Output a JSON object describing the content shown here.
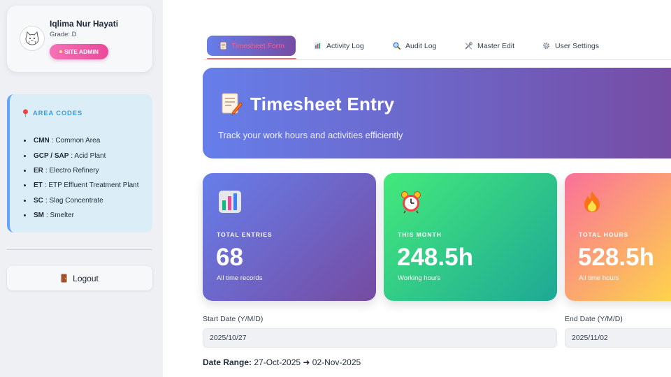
{
  "profile": {
    "name": "Iqlima Nur Hayati",
    "grade": "Grade: D",
    "badge": "SITE ADMIN"
  },
  "area_codes": {
    "title": "AREA CODES",
    "items": [
      {
        "code": "CMN",
        "name": ": Common Area"
      },
      {
        "code": "GCP / SAP",
        "name": ": Acid Plant"
      },
      {
        "code": "ER",
        "name": ": Electro Refinery"
      },
      {
        "code": "ET",
        "name": ": ETP Effluent Treatment Plant"
      },
      {
        "code": "SC",
        "name": ": Slag Concentrate"
      },
      {
        "code": "SM",
        "name": ": Smelter"
      }
    ]
  },
  "logout_label": "Logout",
  "tabs": [
    {
      "label": "Timesheet Form",
      "icon": "document-icon",
      "active": true
    },
    {
      "label": "Activity Log",
      "icon": "bar-chart-icon",
      "active": false
    },
    {
      "label": "Audit Log",
      "icon": "magnifier-icon",
      "active": false
    },
    {
      "label": "Master Edit",
      "icon": "tools-icon",
      "active": false
    },
    {
      "label": "User Settings",
      "icon": "gear-icon",
      "active": false
    }
  ],
  "hero": {
    "title": "Timesheet Entry",
    "subtitle": "Track your work hours and activities efficiently"
  },
  "stats": [
    {
      "label": "TOTAL ENTRIES",
      "value": "68",
      "sub": "All time records",
      "icon": "bar-chart-icon"
    },
    {
      "label": "THIS MONTH",
      "value": "248.5h",
      "sub": "Working hours",
      "icon": "alarm-clock-icon"
    },
    {
      "label": "TOTAL HOURS",
      "value": "528.5h",
      "sub": "All time hours",
      "icon": "fire-icon"
    }
  ],
  "dates": {
    "start_label": "Start Date (Y/M/D)",
    "start_value": "2025/10/27",
    "end_label": "End Date (Y/M/D)",
    "end_value": "2025/11/02",
    "range_label": "Date Range:",
    "range_value": "27-Oct-2025 ➜ 02-Nov-2025"
  },
  "colors": {
    "primary_gradient_start": "#667eea",
    "primary_gradient_end": "#764ba2",
    "green_gradient_start": "#43e97b",
    "green_gradient_end": "#1ea896",
    "orange_gradient_start": "#fa709a",
    "orange_gradient_end": "#fee140",
    "admin_badge": "#ec4899",
    "area_accent": "#3b9ed9"
  }
}
